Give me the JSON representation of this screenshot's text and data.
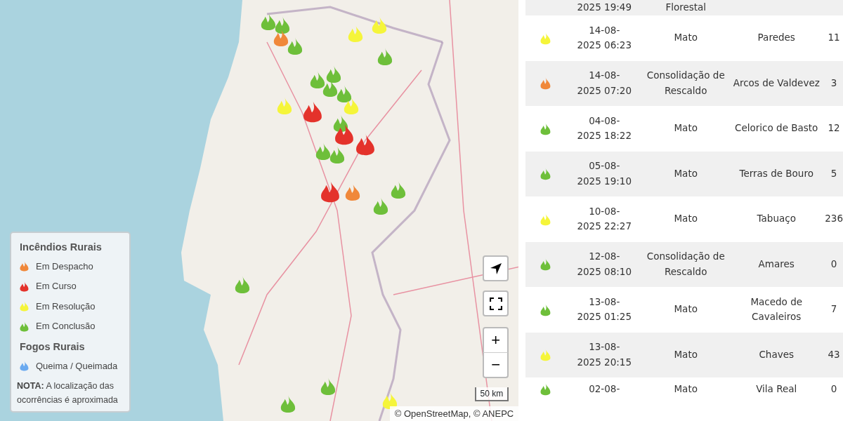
{
  "map": {
    "markers": [
      {
        "color": "#6ebf3a"
      },
      {
        "color": "#6ebf3a"
      },
      {
        "color": "#f0883a"
      },
      {
        "color": "#6ebf3a"
      },
      {
        "color": "#f5f53a"
      },
      {
        "color": "#f5f53a"
      },
      {
        "color": "#6ebf3a"
      },
      {
        "color": "#6ebf3a"
      },
      {
        "color": "#6ebf3a"
      },
      {
        "color": "#6ebf3a"
      },
      {
        "color": "#6ebf3a"
      },
      {
        "color": "#f5f53a"
      },
      {
        "color": "#e4322b"
      },
      {
        "color": "#f5f53a"
      },
      {
        "color": "#6ebf3a"
      },
      {
        "color": "#e4322b"
      },
      {
        "color": "#e4322b"
      },
      {
        "color": "#6ebf3a"
      },
      {
        "color": "#6ebf3a"
      },
      {
        "color": "#e4322b"
      },
      {
        "color": "#f0883a"
      },
      {
        "color": "#6ebf3a"
      },
      {
        "color": "#6ebf3a"
      },
      {
        "color": "#6ebf3a"
      },
      {
        "color": "#6ebf3a"
      },
      {
        "color": "#6ebf3a"
      },
      {
        "color": "#f5f53a"
      }
    ],
    "legend": {
      "sections": [
        {
          "title": "Incêndios Rurais",
          "items": [
            {
              "color": "#f0883a",
              "label": "Em Despacho"
            },
            {
              "color": "#e4322b",
              "label": "Em Curso"
            },
            {
              "color": "#f5f53a",
              "label": "Em Resolução"
            },
            {
              "color": "#6ebf3a",
              "label": "Em Conclusão"
            }
          ]
        },
        {
          "title": "Fogos Rurais",
          "items": [
            {
              "color": "#6aaaf0",
              "label": "Queima / Queimada"
            }
          ]
        }
      ],
      "note": "**NOTA:** A localização das ocorrências é aproximada"
    },
    "scale": "50 km",
    "attribution": "© OpenStreetMap, © ANEPC",
    "zoom_in": "+",
    "zoom_out": "−"
  },
  "table": {
    "rows": [
      {
        "date": "2025 19:49",
        "type": "Florestal"
      },
      {
        "color": "#f5f53a",
        "date": "14-08-\n2025 06:23",
        "type": "Mato",
        "place": "Paredes",
        "count": "11"
      },
      {
        "color": "#f0883a",
        "date": "14-08-\n2025 07:20",
        "type": "Consolidação de Rescaldo",
        "place": "Arcos de Valdevez",
        "count": "3"
      },
      {
        "color": "#6ebf3a",
        "date": "04-08-\n2025 18:22",
        "type": "Mato",
        "place": "Celorico de Basto",
        "count": "12"
      },
      {
        "color": "#6ebf3a",
        "date": "05-08-\n2025 19:10",
        "type": "Mato",
        "place": "Terras de Bouro",
        "count": "5"
      },
      {
        "color": "#f5f53a",
        "date": "10-08-\n2025 22:27",
        "type": "Mato",
        "place": "Tabuaço",
        "count": "236"
      },
      {
        "color": "#6ebf3a",
        "date": "12-08-\n2025 08:10",
        "type": "Consolidação de Rescaldo",
        "place": "Amares",
        "count": "0"
      },
      {
        "color": "#6ebf3a",
        "date": "13-08-\n2025 01:25",
        "type": "Mato",
        "place": "Macedo de Cavaleiros",
        "count": "7"
      },
      {
        "color": "#f5f53a",
        "date": "13-08-\n2025 20:15",
        "type": "Mato",
        "place": "Chaves",
        "count": "43"
      },
      {
        "color": "#6ebf3a",
        "date": "02-08-",
        "type": "Mato",
        "place": "Vila Real",
        "count": "0"
      }
    ]
  }
}
